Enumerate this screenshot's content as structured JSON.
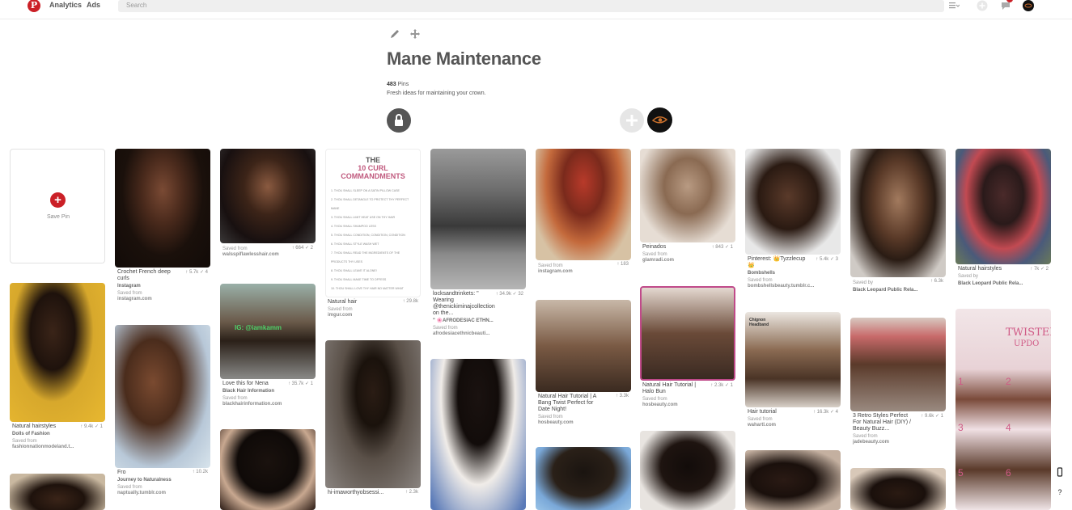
{
  "header": {
    "nav": [
      "Analytics",
      "Ads"
    ],
    "search_placeholder": "Search",
    "icons": [
      "pinterest-logo",
      "view-list-icon",
      "add-icon",
      "messages-icon",
      "profile-avatar"
    ]
  },
  "board": {
    "title": "Mane Maintenance",
    "pin_count": "483",
    "pin_label": "Pins",
    "description": "Fresh ideas for maintaining your crown."
  },
  "save_pin_label": "Save Pin",
  "pins": [
    {
      "title": "Crochet French deep curls",
      "counts": "↑ 5.7k  ✓ 4",
      "board": "Instagram",
      "saved": "Saved from",
      "source": "instagram.com"
    },
    {
      "title": "",
      "counts": "↑ 664  ✓ 2",
      "board": "",
      "saved": "Saved from",
      "source": "walsspiflawlesshair.com"
    },
    {
      "title": "Natural hair",
      "counts": "↑ 29.8k",
      "board": "",
      "saved": "Saved from",
      "source": "imgur.com"
    },
    {
      "title": "locksandtrinkets: \" Wearing @thenickiminajcollection on the...",
      "counts": "↑ 34.9k  ✓ 32",
      "board": "\" 🌸AFRODESIAC ETHN...",
      "saved": "Saved from",
      "source": "afrodesiacethnicbeauti..."
    },
    {
      "title": "",
      "counts": "↑ 183",
      "board": "",
      "saved": "Saved from",
      "source": "instagram.com"
    },
    {
      "title": "Peinados",
      "counts": "↑ 843  ✓ 1",
      "board": "",
      "saved": "Saved from",
      "source": "glamradi.com"
    },
    {
      "title": "Pinterest: 👑Tyzzlecup👑",
      "counts": "↑ 5.4k  ✓ 3",
      "board": "Bombshells",
      "saved": "Saved from",
      "source": "bombshellsbeauty.tumblr.c..."
    },
    {
      "title": "",
      "counts": "↑ 6.3k",
      "board": "Black Leopard Public Rela...",
      "saved": "Saved by",
      "source": ""
    },
    {
      "title": "Natural hairstyles",
      "counts": "↑ 7k  ✓ 2",
      "board": "Black Leopard Public Rela...",
      "saved": "Saved by",
      "source": ""
    },
    {
      "title": "Natural hairstyles",
      "counts": "↑ 9.4k  ✓ 1",
      "board": "Dolls of Fashion",
      "saved": "Saved from",
      "source": "fashionnationmodeland.t..."
    },
    {
      "title": "Fro",
      "counts": "↑ 10.2k",
      "board": "Journey to Naturalness",
      "saved": "Saved from",
      "source": "naptually.tumblr.com"
    },
    {
      "title": "Love this for Nena",
      "counts": "↑ 35.7k  ✓ 1",
      "board": "Black Hair Information",
      "saved": "Saved from",
      "source": "blackhairinformation.com"
    },
    {
      "title": "Natural Hair Tutorial | A Bang Twist Perfect for Date Night!",
      "counts": "↑ 3.3k",
      "board": "",
      "saved": "Saved from",
      "source": "hosbeauty.com"
    },
    {
      "title": "Natural Hair Tutorial | Halo Bun",
      "counts": "↑ 2.3k  ✓ 1",
      "board": "",
      "saved": "Saved from",
      "source": "hosbeauty.com"
    },
    {
      "title": "Hair tutorial",
      "counts": "↑ 16.3k  ✓ 4",
      "board": "",
      "saved": "Saved from",
      "source": "wahartl.com"
    },
    {
      "title": "3 Retro Styles Perfect For Natural Hair (DIY) / Beauty Buzz...",
      "counts": "↑ 9.6k  ✓ 1",
      "board": "",
      "saved": "Saved from",
      "source": "jadebeauty.com"
    },
    {
      "title": "hi-imaworthyobsessi...",
      "counts": "↑ 2.3k",
      "board": "",
      "saved": "",
      "source": ""
    }
  ],
  "card_text": {
    "cmd_title_1": "THE",
    "cmd_title_2": "10 CURL COMMANDMENTS",
    "cmd_lines": [
      "1. THOU SHALL SLEEP ON A SATIN PILLOW CASE",
      "2. THOU SHALL DETANGLE TO PROTECT THY PERFECT MANE",
      "3. THOU SHALL LIMIT HEAT USE ON THY HAIR",
      "4. THOU SHALL SHAMPOO LESS",
      "5. THOU SHALL CONDITION, CONDITION, CONDITION",
      "6. THOU SHALL STYLE WASH WET",
      "7. THOU SHALL READ THE INGREDIENTS OF THE PRODUCTS THY USES",
      "8. THOU SHALL LEAVE IT ALONE!",
      "9. THOU SHALL MAKE TIME TO OFFESS",
      "10. THOU SHALL LOVE THY HAIR NO MATTER WHAT"
    ],
    "ig_tag": "IG: @iamkamm",
    "chignon": "Chignon Headband",
    "twisted": "TWISTED",
    "updo": "UPDO",
    "n1": "1",
    "n2": "2",
    "n3": "3",
    "n4": "4",
    "n5": "5",
    "n6": "6"
  },
  "colors": {
    "brand": "#cb2027",
    "card_border": "#e2e2e2"
  }
}
